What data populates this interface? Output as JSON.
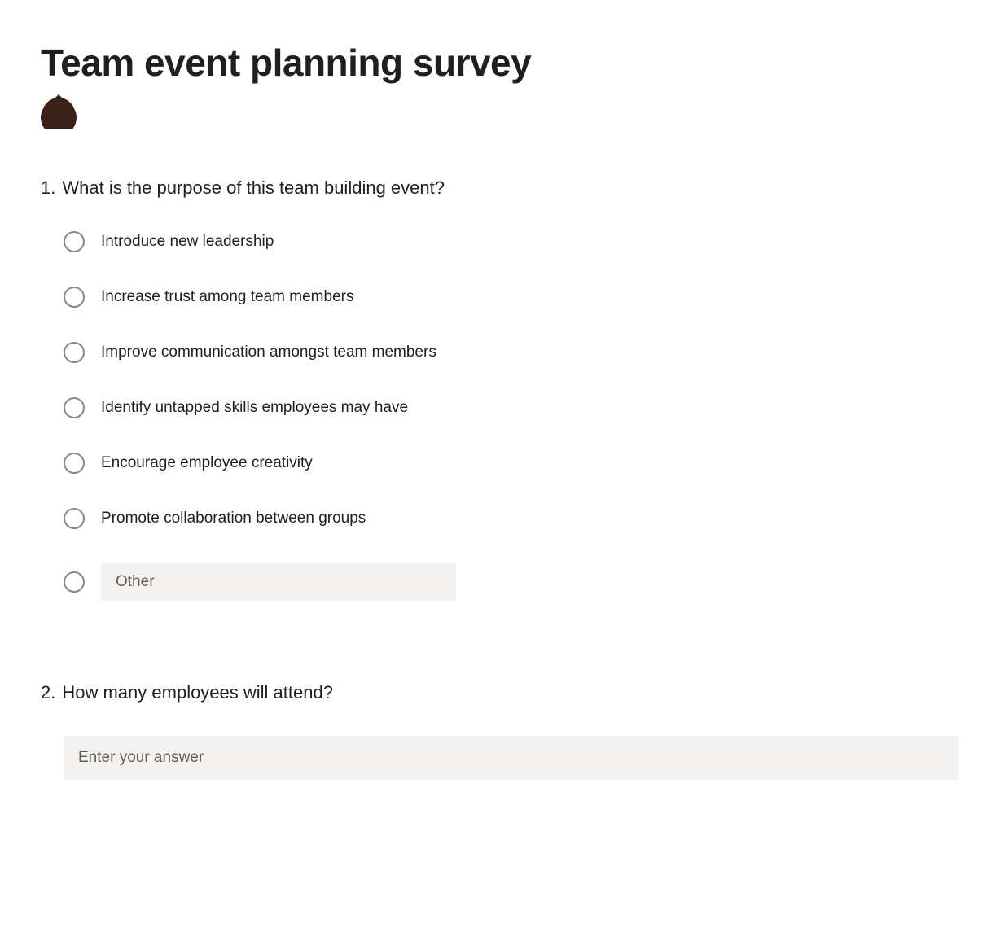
{
  "survey": {
    "title": "Team event planning survey",
    "theme_color": "#3b2218"
  },
  "questions": [
    {
      "number": "1.",
      "text": "What is the purpose of this team building event?",
      "type": "radio",
      "options": [
        "Introduce new leadership",
        "Increase trust among team members",
        "Improve communication amongst team members",
        "Identify untapped skills employees may have",
        "Encourage employee creativity",
        "Promote collaboration between groups"
      ],
      "other_placeholder": "Other"
    },
    {
      "number": "2.",
      "text": "How many employees will attend?",
      "type": "text",
      "placeholder": "Enter your answer"
    }
  ]
}
